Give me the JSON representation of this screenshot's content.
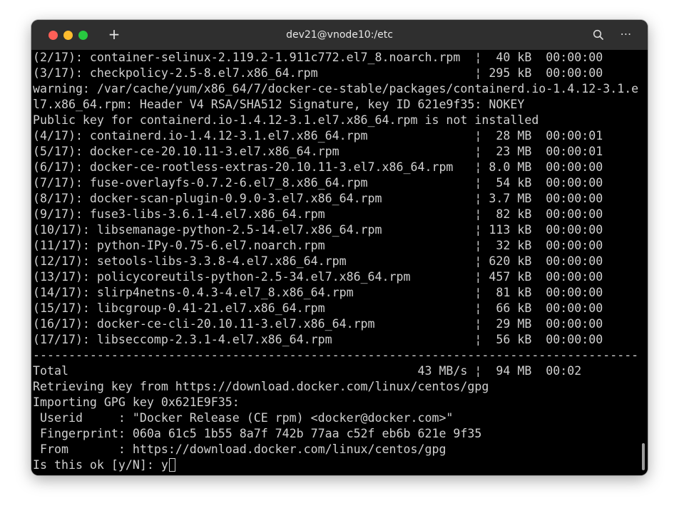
{
  "window": {
    "title": "dev21@vnode10:/etc",
    "new_tab_icon": "plus-icon",
    "search_icon": "search-icon",
    "menu_icon": "more-horizontal-icon",
    "menu_glyph": "⋯"
  },
  "terminal": {
    "lines": [
      "(2/17): container-selinux-2.119.2-1.911c772.el7_8.noarch.rpm  ¦  40 kB  00:00:00",
      "(3/17): checkpolicy-2.5-8.el7.x86_64.rpm                      ¦ 295 kB  00:00:00",
      "warning: /var/cache/yum/x86_64/7/docker-ce-stable/packages/containerd.io-1.4.12-3.1.e",
      "l7.x86_64.rpm: Header V4 RSA/SHA512 Signature, key ID 621e9f35: NOKEY",
      "Public key for containerd.io-1.4.12-3.1.el7.x86_64.rpm is not installed",
      "(4/17): containerd.io-1.4.12-3.1.el7.x86_64.rpm               ¦  28 MB  00:00:01",
      "(5/17): docker-ce-20.10.11-3.el7.x86_64.rpm                   ¦  23 MB  00:00:01",
      "(6/17): docker-ce-rootless-extras-20.10.11-3.el7.x86_64.rpm   ¦ 8.0 MB  00:00:00",
      "(7/17): fuse-overlayfs-0.7.2-6.el7_8.x86_64.rpm               ¦  54 kB  00:00:00",
      "(8/17): docker-scan-plugin-0.9.0-3.el7.x86_64.rpm             ¦ 3.7 MB  00:00:00",
      "(9/17): fuse3-libs-3.6.1-4.el7.x86_64.rpm                     ¦  82 kB  00:00:00",
      "(10/17): libsemanage-python-2.5-14.el7.x86_64.rpm             ¦ 113 kB  00:00:00",
      "(11/17): python-IPy-0.75-6.el7.noarch.rpm                     ¦  32 kB  00:00:00",
      "(12/17): setools-libs-3.3.8-4.el7.x86_64.rpm                  ¦ 620 kB  00:00:00",
      "(13/17): policycoreutils-python-2.5-34.el7.x86_64.rpm         ¦ 457 kB  00:00:00",
      "(14/17): slirp4netns-0.4.3-4.el7_8.x86_64.rpm                 ¦  81 kB  00:00:00",
      "(15/17): libcgroup-0.41-21.el7.x86_64.rpm                     ¦  66 kB  00:00:00",
      "(16/17): docker-ce-cli-20.10.11-3.el7.x86_64.rpm              ¦  29 MB  00:00:00",
      "(17/17): libseccomp-2.3.1-4.el7.x86_64.rpm                    ¦  56 kB  00:00:00",
      "-------------------------------------------------------------------------------------",
      "Total                                                 43 MB/s ¦  94 MB  00:02",
      "Retrieving key from https://download.docker.com/linux/centos/gpg",
      "Importing GPG key 0x621E9F35:",
      " Userid     : \"Docker Release (CE rpm) <docker@docker.com>\"",
      " Fingerprint: 060a 61c5 1b55 8a7f 742b 77aa c52f eb6b 621e 9f35",
      " From       : https://download.docker.com/linux/centos/gpg"
    ],
    "prompt": "Is this ok [y/N]: ",
    "input_value": "y"
  }
}
